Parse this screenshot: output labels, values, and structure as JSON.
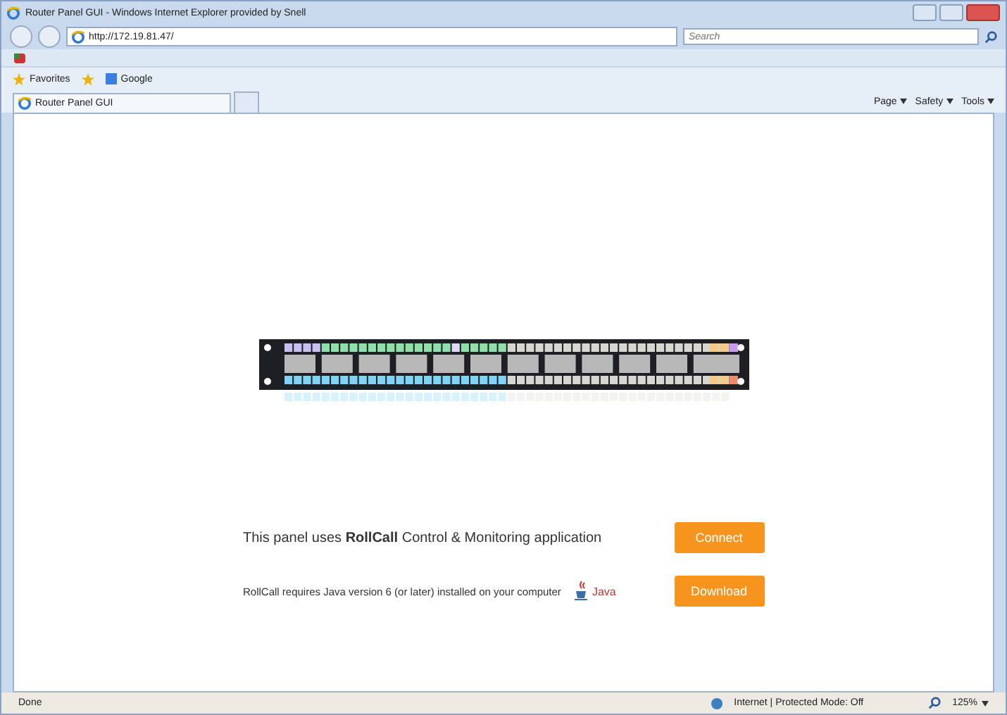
{
  "window": {
    "title": "Router Panel GUI - Windows Internet Explorer provided by Snell"
  },
  "address_bar": {
    "url": "http://172.19.81.47/",
    "search_placeholder": "Search"
  },
  "favorites_bar": {
    "label": "Favorites",
    "links": [
      "Google"
    ]
  },
  "tab": {
    "label": "Router Panel GUI",
    "selected": true
  },
  "command_bar": [
    "Page",
    "Safety",
    "Tools"
  ],
  "content": {
    "intro": "This panel uses **RollCall** Control & Monitoring application",
    "requirement": "RollCall requires Java version 6 (or later) installed on your computer",
    "java_label": "Java",
    "buttons": [
      "Connect",
      "Download"
    ]
  },
  "status_bar": {
    "status": "Done",
    "zone": "Internet | Protected Mode: Off",
    "zoom": "125%"
  }
}
